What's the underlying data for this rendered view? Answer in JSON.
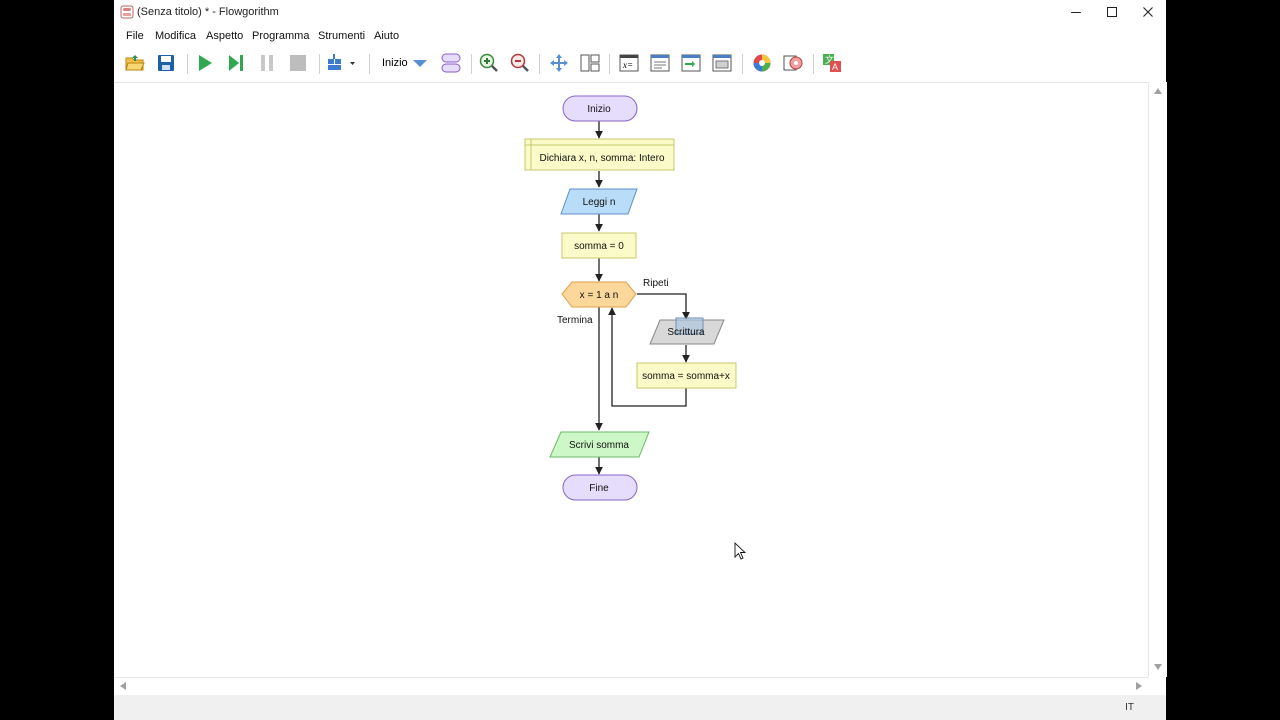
{
  "window": {
    "title": "(Senza titolo) * - Flowgorithm"
  },
  "menu": [
    "File",
    "Modifica",
    "Aspetto",
    "Programma",
    "Strumenti",
    "Aiuto"
  ],
  "toolbar": {
    "layout_label": "Inizio"
  },
  "flowchart": {
    "start": "Inizio",
    "declare": "Dichiara x, n, somma: Intero",
    "input": "Leggi n",
    "assign_init": "somma = 0",
    "loop": "x = 1 a n",
    "loop_true_label": "Ripeti",
    "loop_exit_label": "Termina",
    "output_inner": "Scrittura",
    "assign_loop": "somma = somma+x",
    "output_final": "Scrivi somma",
    "end": "Fine"
  },
  "status": {
    "locale": "IT"
  },
  "colors": {
    "terminal": "#e6dcfb",
    "declare": "#fafbc8",
    "input": "#b9dcf9",
    "assign": "#fafbc8",
    "loop": "#fbd79b",
    "output_inner": "#d8d8d8",
    "output": "#cdf7c6"
  }
}
